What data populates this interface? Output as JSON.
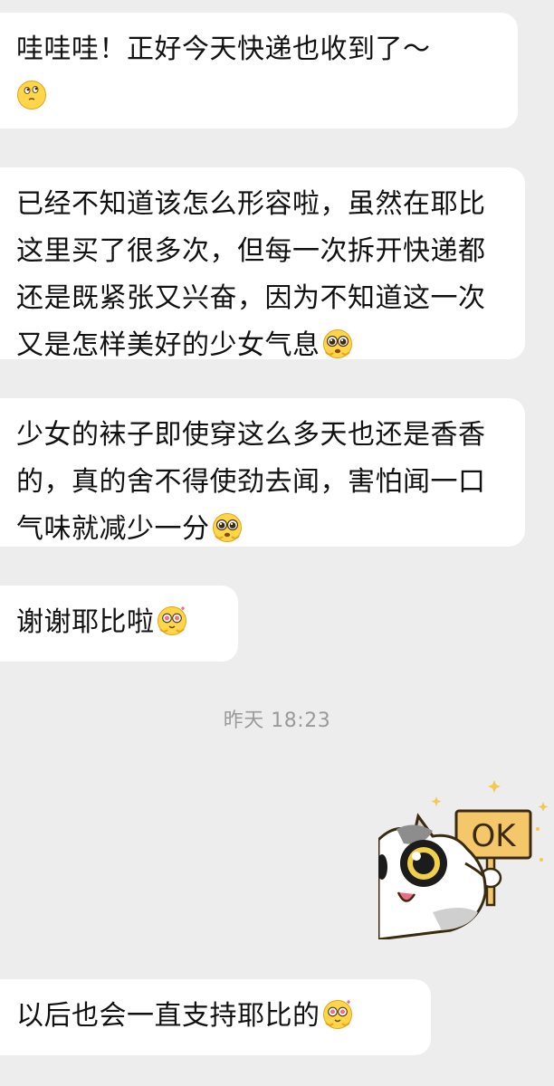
{
  "messages": [
    {
      "text": "哇哇哇！正好今天快递也收到了～",
      "emoji": "thinking-face-emoji"
    },
    {
      "text": "已经不知道该怎么形容啦，虽然在耶比这里买了很多次，但每一次拆开快递都还是既紧张又兴奋，因为不知道这一次又是怎样美好的少女气息",
      "emoji": "pleading-face-emoji"
    },
    {
      "text": "少女的袜子即使穿这么多天也还是香香的，真的舍不得使劲去闻，害怕闻一口气味就减少一分",
      "emoji": "pleading-face-emoji"
    },
    {
      "text": "谢谢耶比啦",
      "emoji": "heart-eyes-pleading-emoji"
    },
    {
      "text": "以后也会一直支持耶比的",
      "emoji": "heart-eyes-pleading-emoji"
    }
  ],
  "timestamp": "昨天 18:23",
  "sticker": {
    "sign_text": "OK",
    "description_icon": "cat-ok-sign-sticker"
  }
}
